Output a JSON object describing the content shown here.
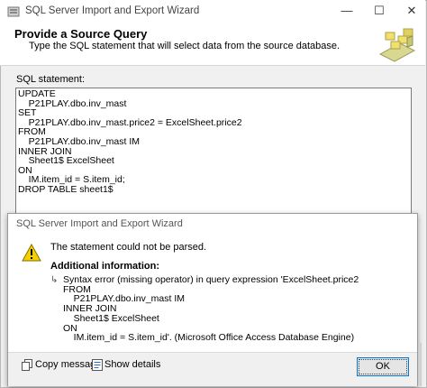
{
  "window": {
    "title": "SQL Server Import and Export Wizard",
    "buttons": {
      "minimize": "—",
      "maximize": "☐",
      "close": "✕"
    }
  },
  "header": {
    "title": "Provide a Source Query",
    "subtitle": "Type the SQL statement that will select data from the source database."
  },
  "sql_editor": {
    "label": "SQL statement:",
    "text": "UPDATE\n    P21PLAY.dbo.inv_mast\nSET\n    P21PLAY.dbo.inv_mast.price2 = ExcelSheet.price2\nFROM\n    P21PLAY.dbo.inv_mast IM\nINNER JOIN\n    Sheet1$ ExcelSheet\nON\n    IM.item_id = S.item_id;\nDROP TABLE sheet1$"
  },
  "dialog": {
    "title": "SQL Server Import and Export Wizard",
    "icon": "warning-icon",
    "message": "The statement could not be parsed.",
    "additional_heading": "Additional information:",
    "arrow": "↳",
    "detail": "Syntax error (missing operator) in query expression 'ExcelSheet.price2\nFROM\n    P21PLAY.dbo.inv_mast IM\nINNER JOIN\n    Sheet1$ ExcelSheet\nON\n    IM.item_id = S.item_id'. (Microsoft Office Access Database Engine)",
    "copy_label": "Copy message",
    "show_details_label": "Show details",
    "ok_label": "OK"
  }
}
